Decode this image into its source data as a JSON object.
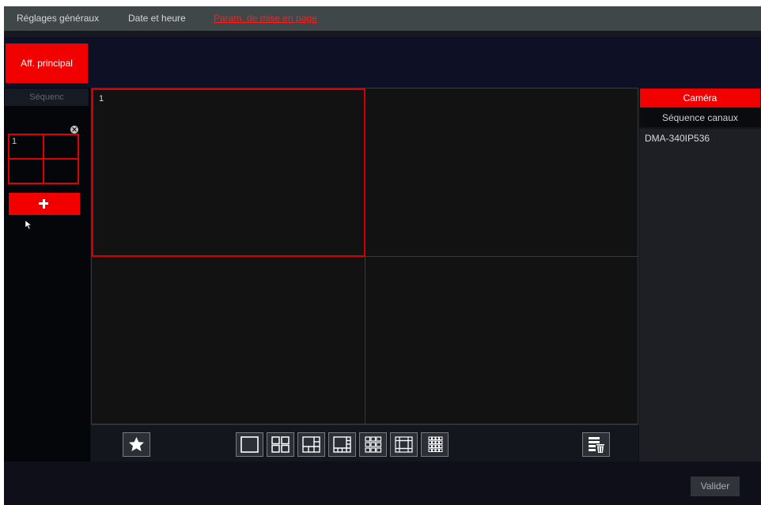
{
  "tabs": [
    {
      "label": "Réglages généraux",
      "active": false
    },
    {
      "label": "Date et heure",
      "active": false
    },
    {
      "label": "Param. de mise en page",
      "active": true
    }
  ],
  "view": {
    "main_button": "Aff. principal"
  },
  "sequence": {
    "header": "Séquenc",
    "thumbnail_label": "1",
    "close_icon": "close-icon",
    "add_icon": "plus-icon"
  },
  "grid": {
    "layout": "2x2",
    "selected_cell_label": "1"
  },
  "toolbar": {
    "icons": [
      "star-icon",
      "layout-1-icon",
      "layout-4-icon",
      "layout-6-icon",
      "layout-8-icon",
      "layout-9-icon",
      "layout-13-icon",
      "layout-16-icon",
      "clear-layout-icon"
    ]
  },
  "right_panel": {
    "tabs": [
      "Caméra",
      "Séquence canaux"
    ],
    "active_tab": "Caméra",
    "cameras": [
      "DMA-340IP536"
    ]
  },
  "footer": {
    "confirm_label": "Valider"
  },
  "colors": {
    "accent": "#f20000",
    "background": "#0e0f18",
    "topbar": "#3f4748",
    "active_tab_text": "#ff1e1e"
  }
}
